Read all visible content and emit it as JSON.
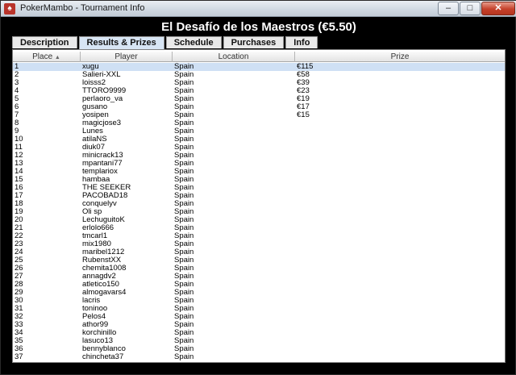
{
  "window": {
    "title": "PokerMambo - Tournament Info",
    "logo_letter": "♠"
  },
  "controls": {
    "minimize": "–",
    "maximize": "□",
    "close": "✕"
  },
  "heading": "El Desafío de los Maestros (€5.50)",
  "tabs": [
    "Description",
    "Results & Prizes",
    "Schedule",
    "Purchases",
    "Info"
  ],
  "active_tab": 1,
  "columns": {
    "place": "Place",
    "player": "Player",
    "location": "Location",
    "prize": "Prize"
  },
  "sort_indicator": "▲",
  "rows": [
    {
      "place": "1",
      "player": "xugu",
      "location": "Spain",
      "prize": "€115"
    },
    {
      "place": "2",
      "player": "Salieri-XXL",
      "location": "Spain",
      "prize": "€58"
    },
    {
      "place": "3",
      "player": "loisss2",
      "location": "Spain",
      "prize": "€39"
    },
    {
      "place": "4",
      "player": "TTORO9999",
      "location": "Spain",
      "prize": "€23"
    },
    {
      "place": "5",
      "player": "perlaoro_va",
      "location": "Spain",
      "prize": "€19"
    },
    {
      "place": "6",
      "player": "gusano",
      "location": "Spain",
      "prize": "€17"
    },
    {
      "place": "7",
      "player": "yosipen",
      "location": "Spain",
      "prize": "€15"
    },
    {
      "place": "8",
      "player": "magicjose3",
      "location": "Spain",
      "prize": ""
    },
    {
      "place": "9",
      "player": "Lunes",
      "location": "Spain",
      "prize": ""
    },
    {
      "place": "10",
      "player": "atilaNS",
      "location": "Spain",
      "prize": ""
    },
    {
      "place": "11",
      "player": "diuk07",
      "location": "Spain",
      "prize": ""
    },
    {
      "place": "12",
      "player": "minicrack13",
      "location": "Spain",
      "prize": ""
    },
    {
      "place": "13",
      "player": "mpantani77",
      "location": "Spain",
      "prize": ""
    },
    {
      "place": "14",
      "player": "templariox",
      "location": "Spain",
      "prize": ""
    },
    {
      "place": "15",
      "player": "hambaa",
      "location": "Spain",
      "prize": ""
    },
    {
      "place": "16",
      "player": "THE SEEKER",
      "location": "Spain",
      "prize": ""
    },
    {
      "place": "17",
      "player": "PACOBAD18",
      "location": "Spain",
      "prize": ""
    },
    {
      "place": "18",
      "player": "conquelyv",
      "location": "Spain",
      "prize": ""
    },
    {
      "place": "19",
      "player": "Oli sp",
      "location": "Spain",
      "prize": ""
    },
    {
      "place": "20",
      "player": "LechuguitoK",
      "location": "Spain",
      "prize": ""
    },
    {
      "place": "21",
      "player": "erlolo666",
      "location": "Spain",
      "prize": ""
    },
    {
      "place": "22",
      "player": "tmcarl1",
      "location": "Spain",
      "prize": ""
    },
    {
      "place": "23",
      "player": "mix1980",
      "location": "Spain",
      "prize": ""
    },
    {
      "place": "24",
      "player": "maribel1212",
      "location": "Spain",
      "prize": ""
    },
    {
      "place": "25",
      "player": "RubenstXX",
      "location": "Spain",
      "prize": ""
    },
    {
      "place": "26",
      "player": "chemita1008",
      "location": "Spain",
      "prize": ""
    },
    {
      "place": "27",
      "player": "annagdv2",
      "location": "Spain",
      "prize": ""
    },
    {
      "place": "28",
      "player": "atletico150",
      "location": "Spain",
      "prize": ""
    },
    {
      "place": "29",
      "player": "almogavars4",
      "location": "Spain",
      "prize": ""
    },
    {
      "place": "30",
      "player": "lacris",
      "location": "Spain",
      "prize": ""
    },
    {
      "place": "31",
      "player": "toninoo",
      "location": "Spain",
      "prize": ""
    },
    {
      "place": "32",
      "player": "Pelos4",
      "location": "Spain",
      "prize": ""
    },
    {
      "place": "33",
      "player": "athor99",
      "location": "Spain",
      "prize": ""
    },
    {
      "place": "34",
      "player": "korchinillo",
      "location": "Spain",
      "prize": ""
    },
    {
      "place": "35",
      "player": "lasuco13",
      "location": "Spain",
      "prize": ""
    },
    {
      "place": "36",
      "player": "bennyblanco",
      "location": "Spain",
      "prize": ""
    },
    {
      "place": "37",
      "player": "chincheta37",
      "location": "Spain",
      "prize": ""
    }
  ]
}
